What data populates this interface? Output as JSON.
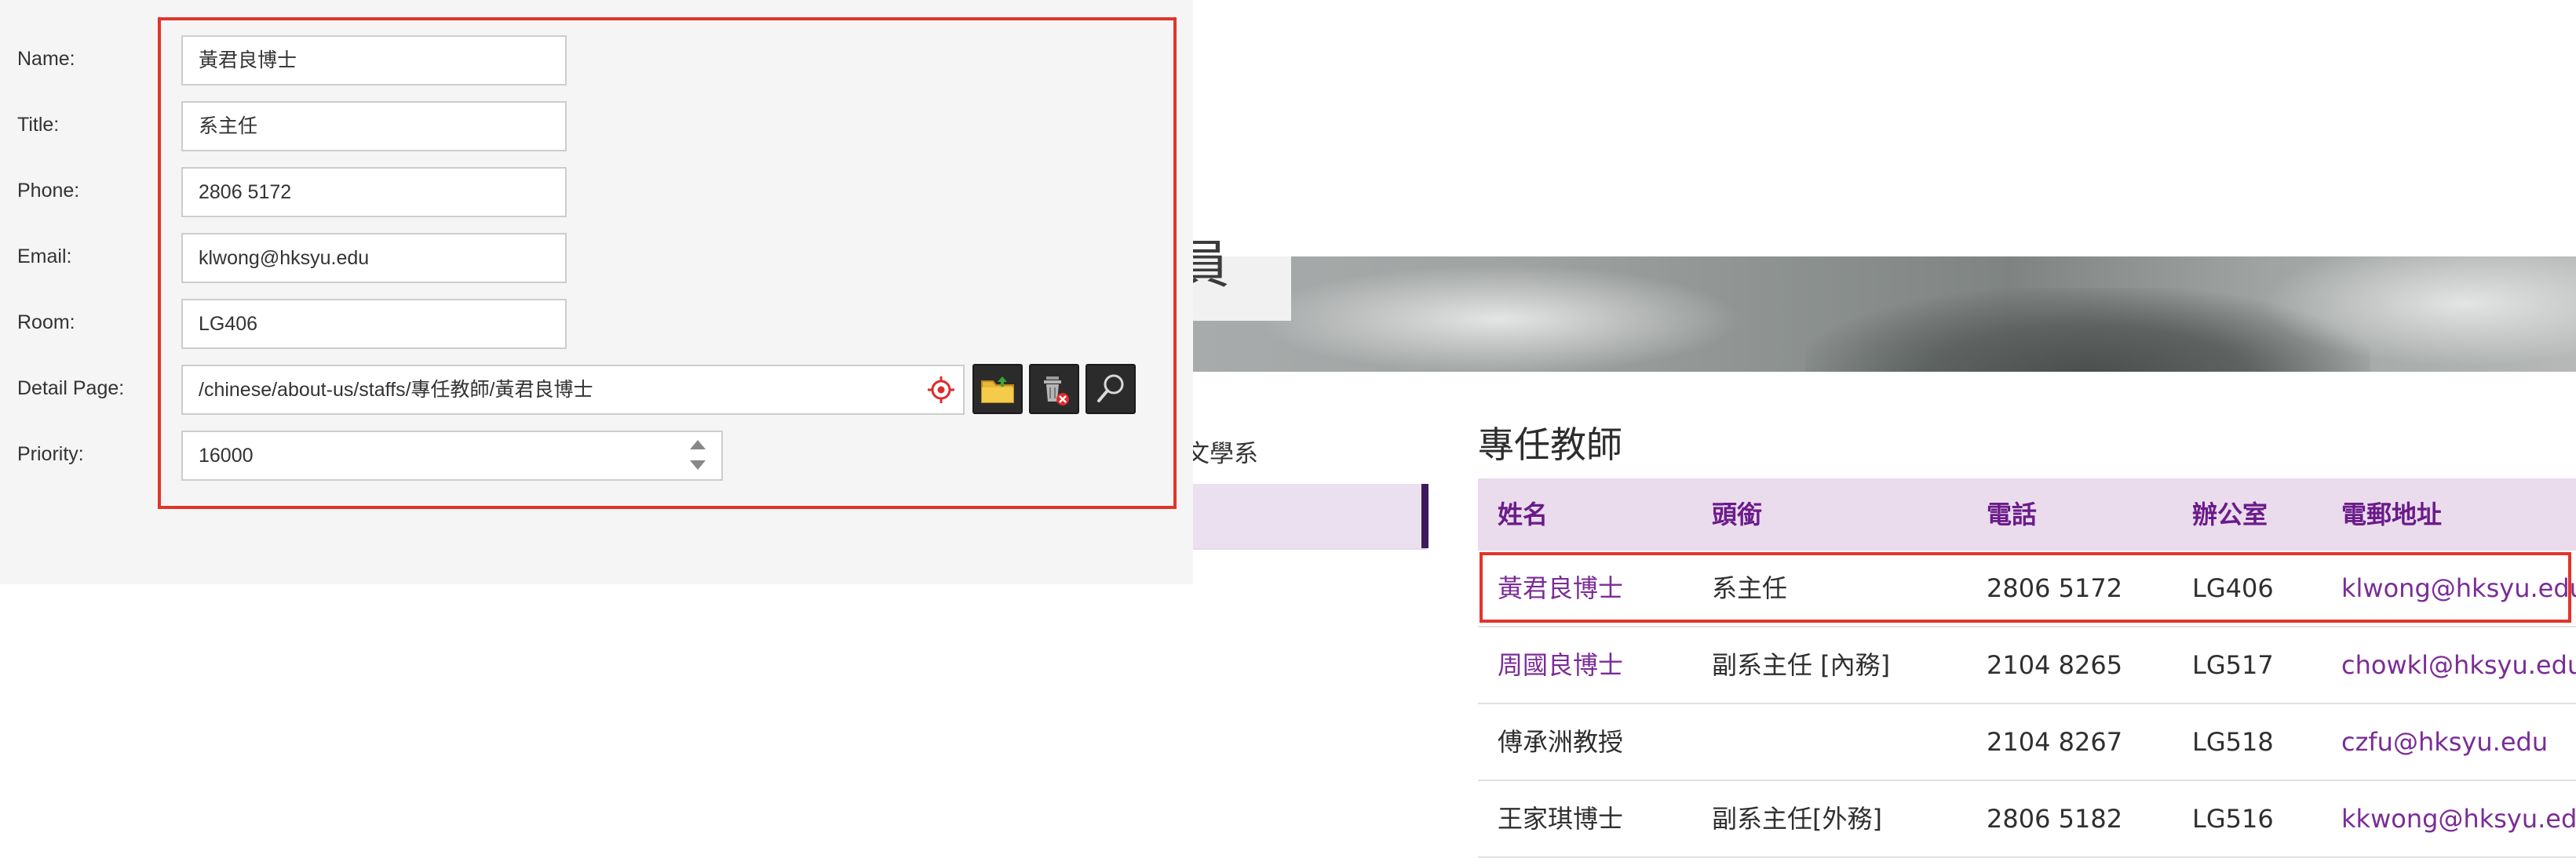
{
  "editor": {
    "fields": {
      "name": {
        "label": "Name:",
        "value": "黃君良博士"
      },
      "title": {
        "label": "Title:",
        "value": "系主任"
      },
      "phone": {
        "label": "Phone:",
        "value": "2806 5172"
      },
      "email": {
        "label": "Email:",
        "value": "klwong@hksyu.edu"
      },
      "room": {
        "label": "Room:",
        "value": "LG406"
      },
      "detail_page": {
        "label": "Detail Page:",
        "value": "/chinese/about-us/staffs/專任教師/黃君良博士"
      },
      "priority": {
        "label": "Priority:",
        "value": "16000"
      }
    },
    "tools": [
      "folder-upload-icon",
      "delete-icon",
      "search-icon"
    ],
    "highlight_color": "#e3342a"
  },
  "website": {
    "banner_glyph": "員",
    "nav": {
      "dept_label": "文學系"
    },
    "section_title": "專任教師",
    "table": {
      "headers": [
        "姓名",
        "頭銜",
        "電話",
        "辦公室",
        "電郵地址"
      ],
      "rows": [
        {
          "name": "黃君良博士",
          "title": "系主任",
          "phone": "2806 5172",
          "room": "LG406",
          "email": "klwong@hksyu.edu"
        },
        {
          "name": "周國良博士",
          "title": "副系主任 [內務]",
          "phone": "2104 8265",
          "room": "LG517",
          "email": "chowkl@hksyu.edu"
        },
        {
          "name": "傅承洲教授",
          "title": "",
          "phone": "2104 8267",
          "room": "LG518",
          "email": "czfu@hksyu.edu"
        },
        {
          "name": "王家琪博士",
          "title": "副系主任[外務]",
          "phone": "2806 5182",
          "room": "LG516",
          "email": "kkwong@hksyu.edu"
        }
      ]
    },
    "accent_color": "#6a1b8a",
    "header_bg": "#eadcec"
  }
}
